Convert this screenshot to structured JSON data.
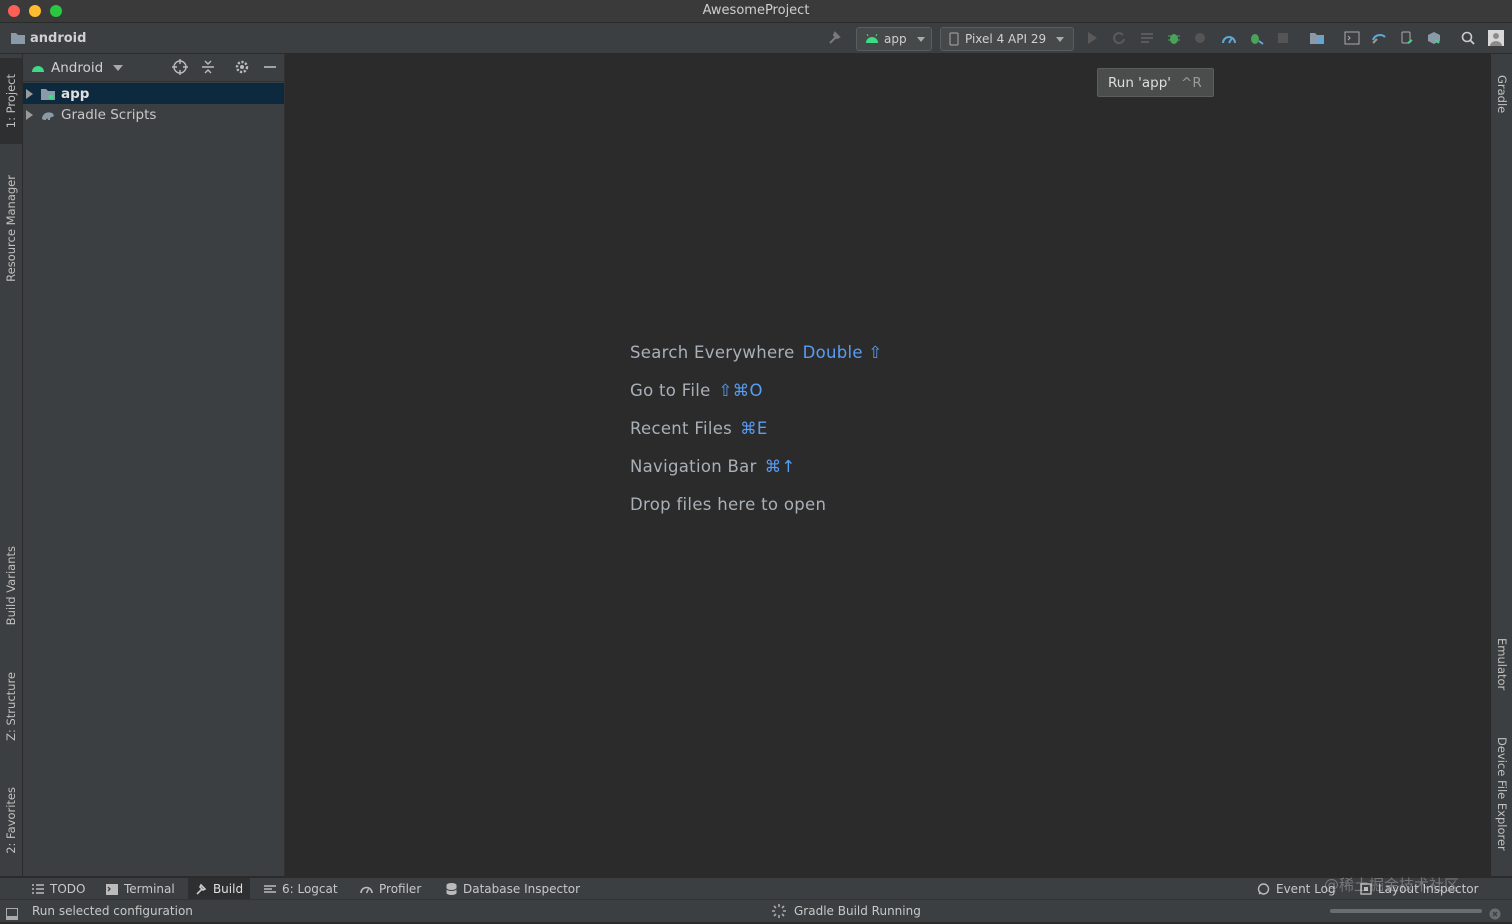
{
  "window": {
    "title": "AwesomeProject"
  },
  "toolbar": {
    "breadcrumb": "android",
    "run_config": "app",
    "device": "Pixel 4 API 29"
  },
  "tooltip": {
    "label": "Run 'app'",
    "shortcut": "^R"
  },
  "left_stripe": {
    "project": "1: Project",
    "resource_manager": "Resource Manager",
    "build_variants": "Build Variants",
    "structure": "Z: Structure",
    "favorites": "2: Favorites"
  },
  "right_stripe": {
    "gradle": "Gradle",
    "emulator": "Emulator",
    "device_file_explorer": "Device File Explorer"
  },
  "project_panel": {
    "view_mode": "Android",
    "tree": [
      {
        "label": "app",
        "selected": true
      },
      {
        "label": "Gradle Scripts",
        "selected": false
      }
    ]
  },
  "editor_hints": [
    {
      "text": "Search Everywhere",
      "key": "Double ⇧"
    },
    {
      "text": "Go to File",
      "key": "⇧⌘O"
    },
    {
      "text": "Recent Files",
      "key": "⌘E"
    },
    {
      "text": "Navigation Bar",
      "key": "⌘↑"
    },
    {
      "text": "Drop files here to open",
      "key": ""
    }
  ],
  "bottom_tabs": {
    "todo": "TODO",
    "terminal": "Terminal",
    "build": "Build",
    "logcat": "6: Logcat",
    "profiler": "Profiler",
    "database_inspector": "Database Inspector",
    "event_log": "Event Log",
    "layout_inspector": "Layout Inspector"
  },
  "status": {
    "message": "Run selected configuration",
    "gradle": "Gradle Build Running"
  },
  "watermark": "@稀土掘金技术社区",
  "colors": {
    "accent_blue": "#589df6",
    "android_green": "#3ddc84",
    "selection": "#0d293e"
  }
}
